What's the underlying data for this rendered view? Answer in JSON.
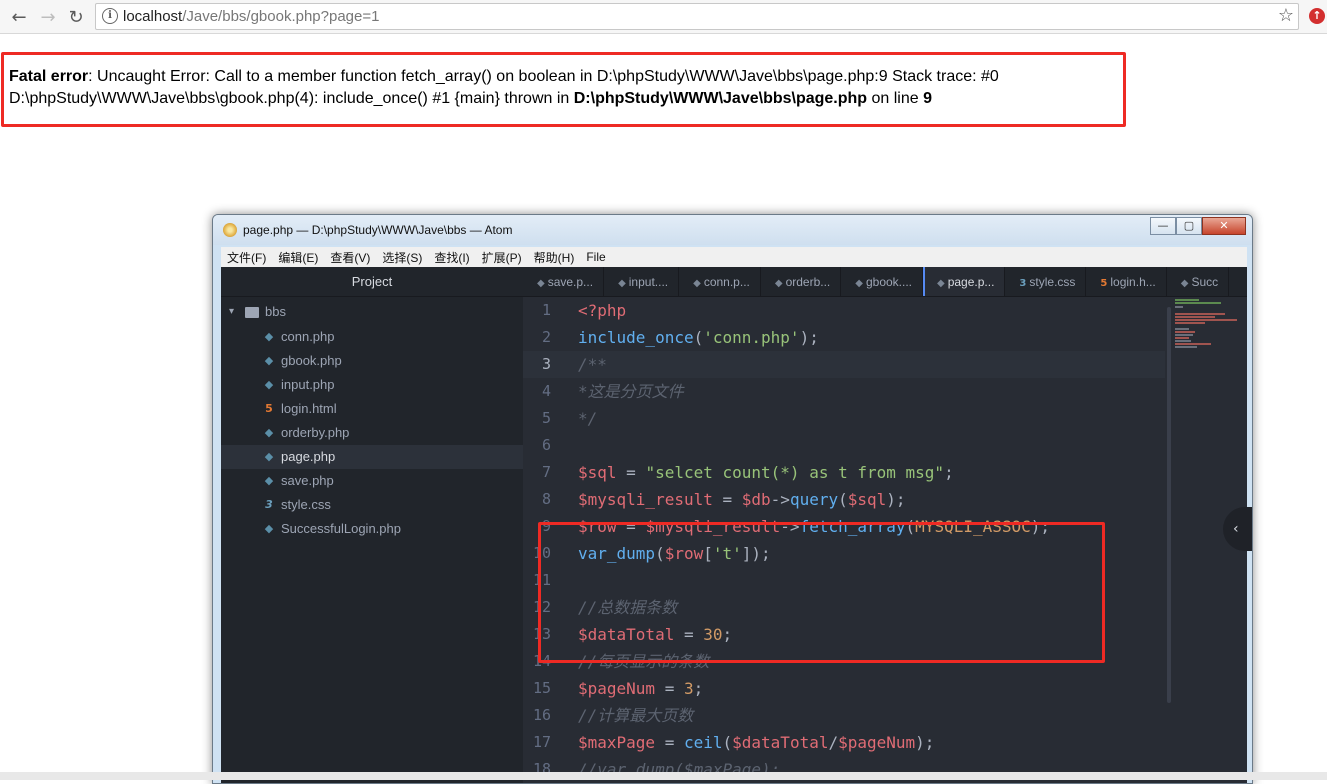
{
  "browser": {
    "url_host": "localhost",
    "url_path": "/Jave/bbs/gbook.php?page=1",
    "back_glyph": "←",
    "forward_glyph": "→",
    "reload_glyph": "↻",
    "info_glyph": "i",
    "star_glyph": "☆",
    "extension_glyph": "↑"
  },
  "error": {
    "label": "Fatal error",
    "message": ": Uncaught Error: Call to a member function fetch_array() on boolean in D:\\phpStudy\\WWW\\Jave\\bbs\\page.php:9 Stack trace: #0 D:\\phpStudy\\WWW\\Jave\\bbs\\gbook.php(4): include_once() #1 {main} thrown in ",
    "file": "D:\\phpStudy\\WWW\\Jave\\bbs\\page.php",
    "on_line": " on line ",
    "line": "9"
  },
  "atom": {
    "title": "page.php — D:\\phpStudy\\WWW\\Jave\\bbs — Atom",
    "window_controls": {
      "minimize": "—",
      "maximize": "▢",
      "close": "✕"
    },
    "menu": [
      "文件(F)",
      "编辑(E)",
      "查看(V)",
      "选择(S)",
      "查找(I)",
      "扩展(P)",
      "帮助(H)",
      "File"
    ],
    "tree": {
      "header": "Project",
      "root": "bbs",
      "files": [
        {
          "name": "conn.php",
          "type": "php"
        },
        {
          "name": "gbook.php",
          "type": "php"
        },
        {
          "name": "input.php",
          "type": "php"
        },
        {
          "name": "login.html",
          "type": "html"
        },
        {
          "name": "orderby.php",
          "type": "php"
        },
        {
          "name": "page.php",
          "type": "php",
          "selected": true
        },
        {
          "name": "save.php",
          "type": "php"
        },
        {
          "name": "style.css",
          "type": "css"
        },
        {
          "name": "SuccessfulLogin.php",
          "type": "php"
        }
      ]
    },
    "tabs": [
      {
        "label": "save.p...",
        "type": "php"
      },
      {
        "label": "input....",
        "type": "php"
      },
      {
        "label": "conn.p...",
        "type": "php"
      },
      {
        "label": "orderb...",
        "type": "php"
      },
      {
        "label": "gbook....",
        "type": "php"
      },
      {
        "label": "page.p...",
        "type": "php",
        "active": true
      },
      {
        "label": "style.css",
        "type": "css"
      },
      {
        "label": "login.h...",
        "type": "html"
      },
      {
        "label": "Succ",
        "type": "php"
      }
    ],
    "line_numbers": [
      "1",
      "2",
      "3",
      "4",
      "5",
      "6",
      "7",
      "8",
      "9",
      "10",
      "11",
      "12",
      "13",
      "14",
      "15",
      "16",
      "17",
      "18"
    ],
    "current_line": "3",
    "code": [
      [
        {
          "c": "tag",
          "t": "<?php"
        }
      ],
      [
        {
          "c": "fn",
          "t": "include_once"
        },
        {
          "c": "pl",
          "t": "("
        },
        {
          "c": "str",
          "t": "'conn.php'"
        },
        {
          "c": "pl",
          "t": ");"
        }
      ],
      [
        {
          "c": "cm",
          "t": "/**"
        }
      ],
      [
        {
          "c": "cm",
          "t": "*这是分页文件"
        }
      ],
      [
        {
          "c": "cm",
          "t": "*/"
        }
      ],
      [],
      [
        {
          "c": "var",
          "t": "$sql"
        },
        {
          "c": "pl",
          "t": " = "
        },
        {
          "c": "str",
          "t": "\"selcet count(*) as t from msg\""
        },
        {
          "c": "pl",
          "t": ";"
        }
      ],
      [
        {
          "c": "var",
          "t": "$mysqli_result"
        },
        {
          "c": "pl",
          "t": " = "
        },
        {
          "c": "var",
          "t": "$db"
        },
        {
          "c": "pl",
          "t": "->"
        },
        {
          "c": "fn",
          "t": "query"
        },
        {
          "c": "pl",
          "t": "("
        },
        {
          "c": "var",
          "t": "$sql"
        },
        {
          "c": "pl",
          "t": ");"
        }
      ],
      [
        {
          "c": "var",
          "t": "$row"
        },
        {
          "c": "pl",
          "t": " = "
        },
        {
          "c": "var",
          "t": "$mysqli_result"
        },
        {
          "c": "pl",
          "t": "->"
        },
        {
          "c": "fn",
          "t": "fetch_array"
        },
        {
          "c": "pl",
          "t": "("
        },
        {
          "c": "const",
          "t": "MYSQLI_ASSOC"
        },
        {
          "c": "pl",
          "t": ");"
        }
      ],
      [
        {
          "c": "fn",
          "t": "var_dump"
        },
        {
          "c": "pl",
          "t": "("
        },
        {
          "c": "var",
          "t": "$row"
        },
        {
          "c": "pl",
          "t": "["
        },
        {
          "c": "str",
          "t": "'t'"
        },
        {
          "c": "pl",
          "t": "]);"
        }
      ],
      [],
      [
        {
          "c": "cm",
          "t": "//总数据条数"
        }
      ],
      [
        {
          "c": "var",
          "t": "$dataTotal"
        },
        {
          "c": "pl",
          "t": " = "
        },
        {
          "c": "num",
          "t": "30"
        },
        {
          "c": "pl",
          "t": ";"
        }
      ],
      [
        {
          "c": "cm",
          "t": "//每页显示的条数"
        }
      ],
      [
        {
          "c": "var",
          "t": "$pageNum"
        },
        {
          "c": "pl",
          "t": " = "
        },
        {
          "c": "num",
          "t": "3"
        },
        {
          "c": "pl",
          "t": ";"
        }
      ],
      [
        {
          "c": "cm",
          "t": "//计算最大页数"
        }
      ],
      [
        {
          "c": "var",
          "t": "$maxPage"
        },
        {
          "c": "pl",
          "t": " = "
        },
        {
          "c": "fn",
          "t": "ceil"
        },
        {
          "c": "pl",
          "t": "("
        },
        {
          "c": "var",
          "t": "$dataTotal"
        },
        {
          "c": "pl",
          "t": "/"
        },
        {
          "c": "var",
          "t": "$pageNum"
        },
        {
          "c": "pl",
          "t": ");"
        }
      ],
      [
        {
          "c": "cm",
          "t": "//var_dump($maxPage);"
        }
      ]
    ],
    "collapse_glyph": "‹"
  }
}
